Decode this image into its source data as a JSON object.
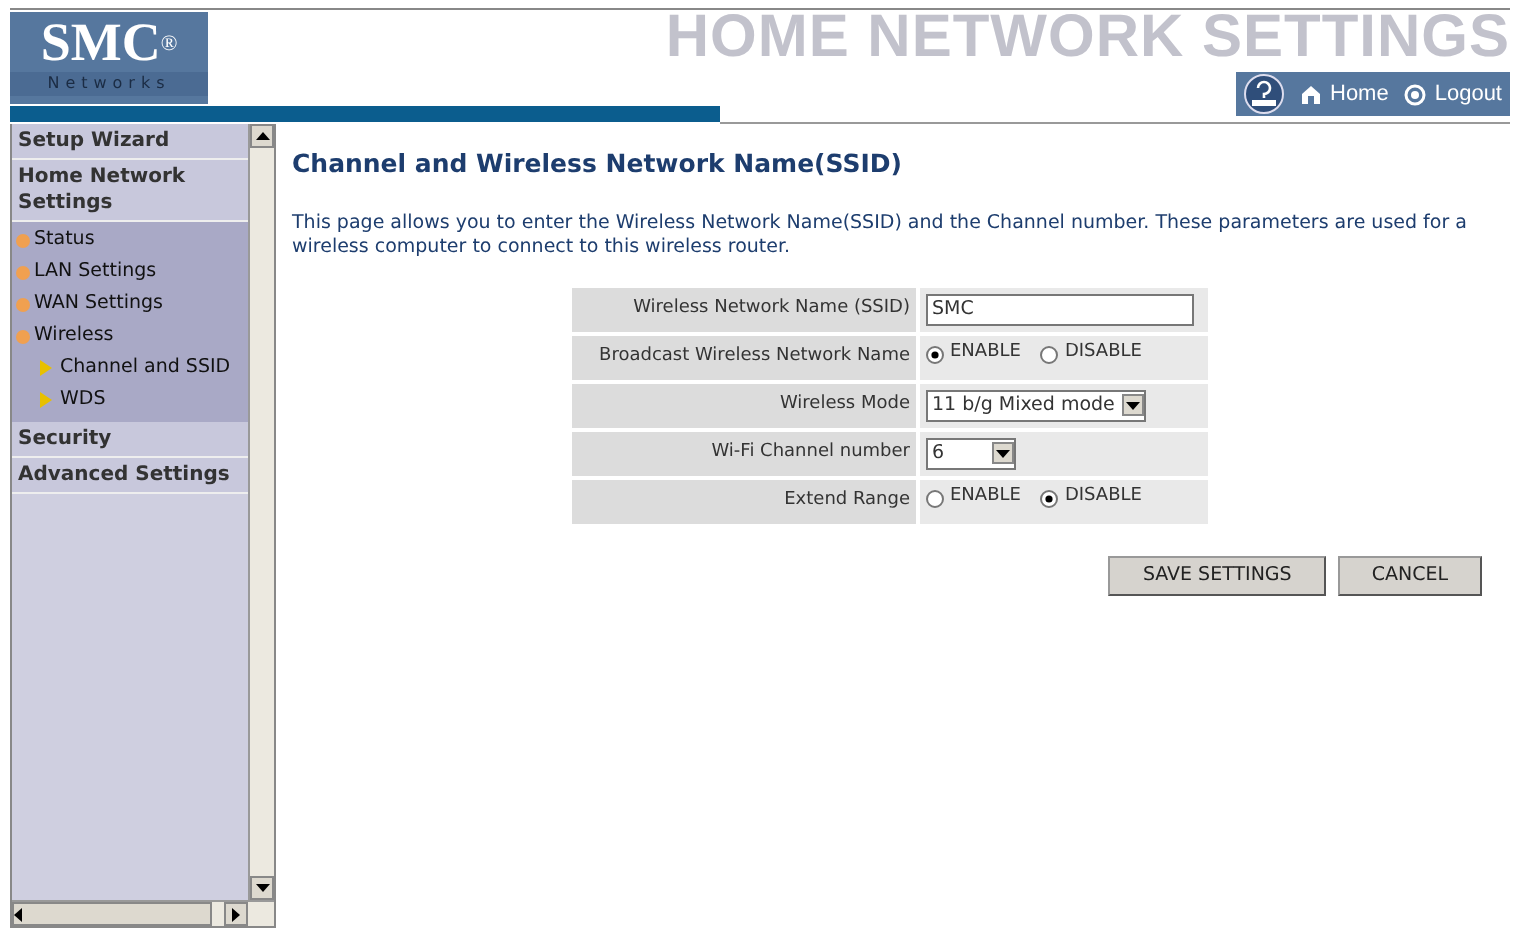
{
  "header": {
    "logo": {
      "brand": "SMC",
      "mark": "®",
      "tagline": "Networks"
    },
    "title": "HOME NETWORK SETTINGS",
    "links": [
      {
        "kind": "help"
      },
      {
        "kind": "home",
        "label": "Home"
      },
      {
        "kind": "logout",
        "label": "Logout"
      }
    ]
  },
  "sidebar": {
    "items": [
      {
        "kind": "section",
        "label": "Setup Wizard"
      },
      {
        "kind": "section",
        "label": "Home Network Settings",
        "children": [
          {
            "kind": "item",
            "label": "Status"
          },
          {
            "kind": "item",
            "label": "LAN Settings"
          },
          {
            "kind": "item",
            "label": "WAN Settings"
          },
          {
            "kind": "item",
            "label": "Wireless",
            "children": [
              {
                "kind": "subitem",
                "label": "Channel and SSID"
              },
              {
                "kind": "subitem",
                "label": "WDS"
              }
            ]
          }
        ]
      },
      {
        "kind": "section",
        "label": "Security"
      },
      {
        "kind": "section",
        "label": "Advanced Settings"
      }
    ]
  },
  "page": {
    "title": "Channel and Wireless Network Name(SSID)",
    "description": "This page allows you to enter the Wireless Network Name(SSID) and the Channel number. These parameters are used for a wireless computer to connect to this wireless router.",
    "form": [
      {
        "kind": "text",
        "label": "Wireless Network Name (SSID)",
        "value": "SMC"
      },
      {
        "kind": "radio",
        "label": "Broadcast Wireless Network Name",
        "options": [
          {
            "label": "ENABLE",
            "checked": true
          },
          {
            "label": "DISABLE",
            "checked": false
          }
        ]
      },
      {
        "kind": "select",
        "label": "Wireless Mode",
        "value": "11 b/g Mixed mode"
      },
      {
        "kind": "select",
        "label": "Wi-Fi Channel number",
        "value": "6"
      },
      {
        "kind": "radio",
        "label": "Extend Range",
        "options": [
          {
            "label": "ENABLE",
            "checked": false
          },
          {
            "label": "DISABLE",
            "checked": true
          }
        ]
      }
    ],
    "buttons": [
      "SAVE SETTINGS",
      "CANCEL"
    ]
  }
}
